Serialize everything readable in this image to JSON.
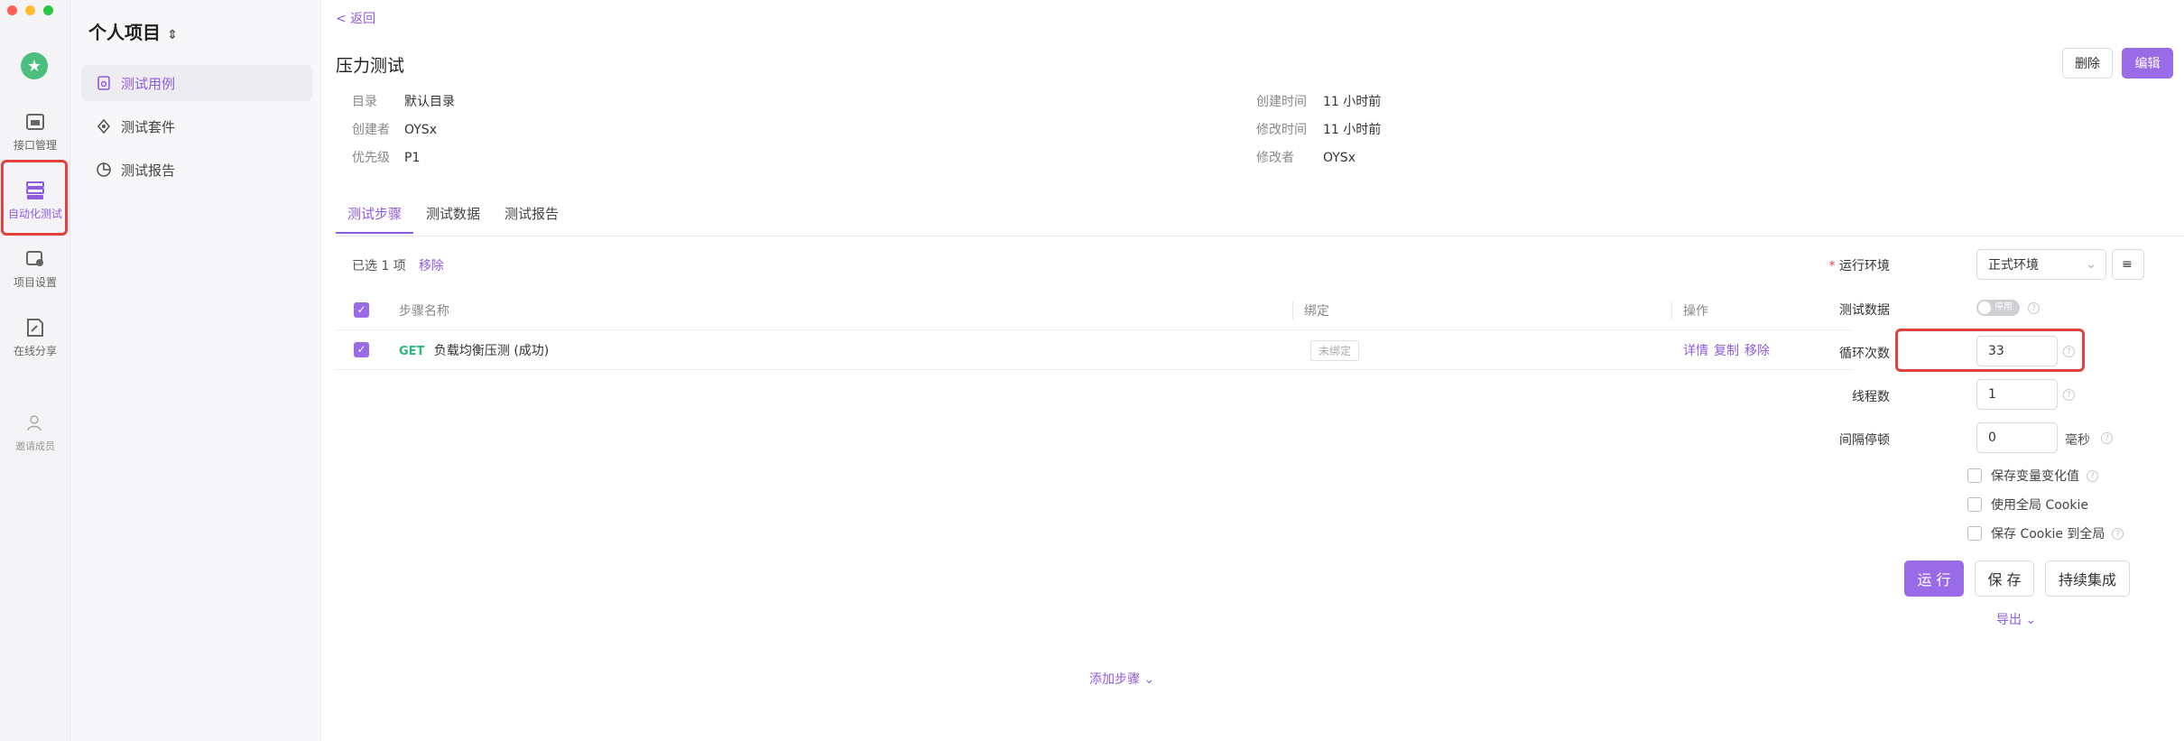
{
  "rail": {
    "items": [
      {
        "label": "接口管理"
      },
      {
        "label": "自动化测试"
      },
      {
        "label": "项目设置"
      },
      {
        "label": "在线分享"
      },
      {
        "label": "邀请成员"
      }
    ]
  },
  "sidebar": {
    "project": "个人项目",
    "items": [
      {
        "label": "测试用例"
      },
      {
        "label": "测试套件"
      },
      {
        "label": "测试报告"
      }
    ]
  },
  "header": {
    "back": "< 返回",
    "title": "压力测试",
    "delete": "删除",
    "edit": "编辑"
  },
  "meta": {
    "dir_k": "目录",
    "dir_v": "默认目录",
    "creator_k": "创建者",
    "creator_v": "OYSx",
    "priority_k": "优先级",
    "priority_v": "P1",
    "created_k": "创建时间",
    "created_v": "11 小时前",
    "modified_k": "修改时间",
    "modified_v": "11 小时前",
    "modifier_k": "修改者",
    "modifier_v": "OYSx"
  },
  "tabs": [
    {
      "label": "测试步骤"
    },
    {
      "label": "测试数据"
    },
    {
      "label": "测试报告"
    }
  ],
  "selection": {
    "text": "已选 1 项",
    "remove": "移除"
  },
  "table": {
    "headers": {
      "name": "步骤名称",
      "bind": "绑定",
      "ops": "操作"
    },
    "rows": [
      {
        "method": "GET",
        "name": "负载均衡压测 (成功)",
        "bind": "未绑定",
        "op1": "详情",
        "op2": "复制",
        "op3": "移除"
      }
    ],
    "add_step": "添加步骤 ⌄"
  },
  "panel": {
    "env_label": "运行环境",
    "env_value": "正式环境",
    "data_label": "测试数据",
    "data_toggle": "停用",
    "loops_label": "循环次数",
    "loops_value": "33",
    "threads_label": "线程数",
    "threads_value": "1",
    "interval_label": "间隔停顿",
    "interval_value": "0",
    "interval_unit": "毫秒",
    "opt1": "保存变量变化值",
    "opt2": "使用全局 Cookie",
    "opt3": "保存 Cookie 到全局",
    "run": "运 行",
    "save": "保 存",
    "ci": "持续集成",
    "export": "导出 ⌄"
  },
  "colors": {
    "accent": "#9a6be6",
    "highlight": "#e54040",
    "get": "#2fb67c"
  }
}
